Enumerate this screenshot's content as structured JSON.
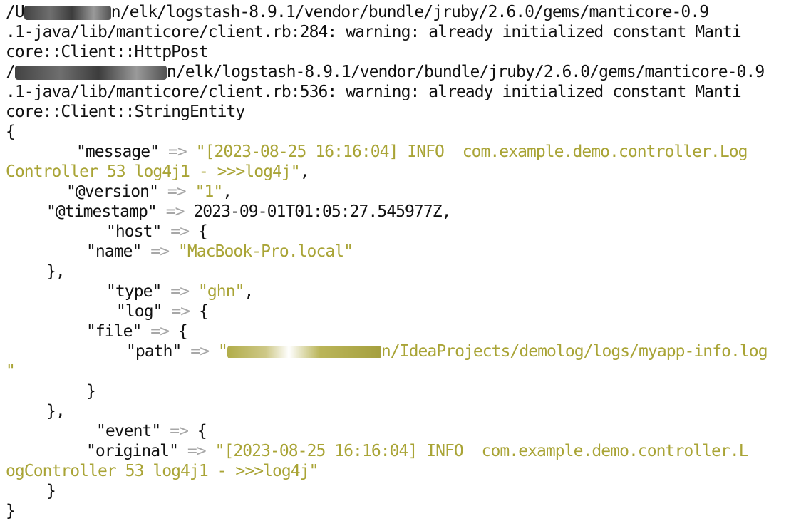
{
  "terminal": {
    "background": "#ffffff",
    "text_color": "#111111",
    "string_color": "#a9a436",
    "arrow_color": "#a7a7a7",
    "warnings": [
      {
        "line1_prefix": "/U",
        "line1_rest": "n/elk/logstash-8.9.1/vendor/bundle/jruby/2.6.0/gems/manticore-0.9",
        "line2": ".1-java/lib/manticore/client.rb:284: warning: already initialized constant Manti",
        "line3": "core::Client::HttpPost"
      },
      {
        "line1_prefix": "/",
        "line1_rest": "n/elk/logstash-8.9.1/vendor/bundle/jruby/2.6.0/gems/manticore-0.9",
        "line2": ".1-java/lib/manticore/client.rb:536: warning: already initialized constant Manti",
        "line3": "core::Client::StringEntity"
      }
    ],
    "open_brace": "{",
    "close_brace": "}",
    "arrow": "=>",
    "message": {
      "key": "\"message\"",
      "value_line1": "\"[2023-08-25 16:16:04] INFO  com.example.demo.controller.Log",
      "value_line2": "Controller 53 log4j1 - >>>log4j\"",
      "comma": ","
    },
    "version": {
      "key": "\"@version\"",
      "value": "\"1\"",
      "comma": ","
    },
    "timestamp": {
      "key": "\"@timestamp\"",
      "value": "2023-09-01T01:05:27.545977Z,"
    },
    "host": {
      "key": "\"host\"",
      "open": "{",
      "name_key": "\"name\"",
      "name_value": "\"MacBook-Pro.local\"",
      "close": "},"
    },
    "type": {
      "key": "\"type\"",
      "value": "\"ghn\"",
      "comma": ","
    },
    "log": {
      "key": "\"log\"",
      "open": "{",
      "file_key": "\"file\"",
      "file_open": "{",
      "path_key": "\"path\"",
      "path_prefix": "\"",
      "path_rest": "n/IdeaProjects/demolog/logs/myapp-info.log",
      "path_wrap": "\"",
      "file_close": "}",
      "close": "},"
    },
    "event": {
      "key": "\"event\"",
      "open": "{",
      "original_key": "\"original\"",
      "original_line1": "\"[2023-08-25 16:16:04] INFO  com.example.demo.controller.L",
      "original_line2": "ogController 53 log4j1 - >>>log4j\"",
      "close": "}"
    }
  }
}
